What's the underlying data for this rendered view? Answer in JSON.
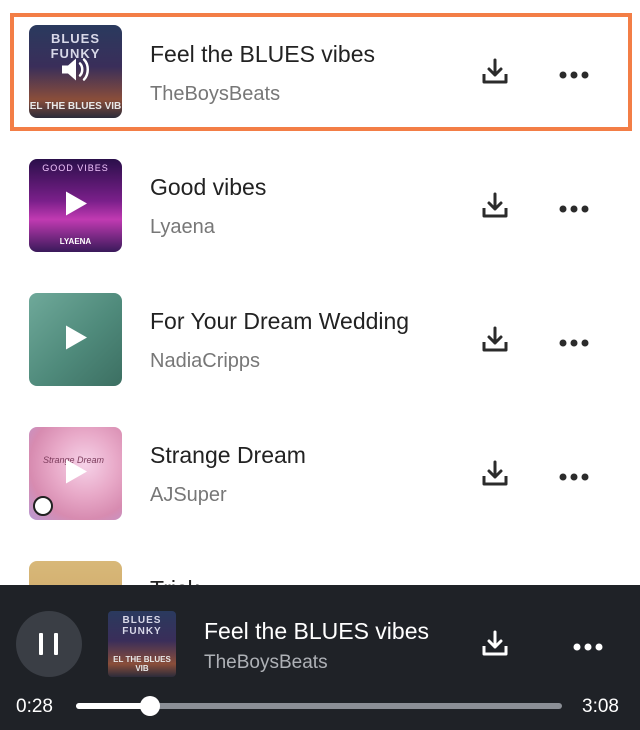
{
  "tracks": [
    {
      "title": "Feel the BLUES vibes",
      "artist": "TheBoysBeats",
      "active": true,
      "state_icon": "speaker-icon",
      "cover": {
        "style": "blues",
        "top_text": "BLUES FUNKY",
        "bottom_text": "EL THE BLUES VIB"
      }
    },
    {
      "title": "Good vibes",
      "artist": "Lyaena",
      "active": false,
      "state_icon": "play-icon",
      "cover": {
        "style": "good",
        "top_text": "GOOD VIBES",
        "bottom_text": "LYAENA"
      }
    },
    {
      "title": "For Your Dream Wedding",
      "artist": "NadiaCripps",
      "active": false,
      "state_icon": "play-icon",
      "cover": {
        "style": "wedding"
      }
    },
    {
      "title": "Strange Dream",
      "artist": "AJSuper",
      "active": false,
      "state_icon": "play-icon",
      "cover": {
        "style": "strange",
        "top_text": "Strange Dream"
      }
    },
    {
      "title": "Trick",
      "artist": "",
      "active": false,
      "state_icon": "",
      "cover": {
        "style": "tricks"
      }
    }
  ],
  "player": {
    "title": "Feel the BLUES vibes",
    "artist": "TheBoysBeats",
    "current_time": "0:28",
    "total_time": "3:08",
    "progress": 0.152,
    "state": "playing",
    "cover": {
      "style": "blues",
      "top_text": "BLUES FUNKY",
      "bottom_text": "EL THE BLUES VIB"
    }
  },
  "colors": {
    "active_border": "#f37e46",
    "player_bg": "#1f2227",
    "icon": "#2b2b2b"
  },
  "icons": {
    "download": "download-icon",
    "more": "more-icon",
    "pause": "pause-icon"
  }
}
